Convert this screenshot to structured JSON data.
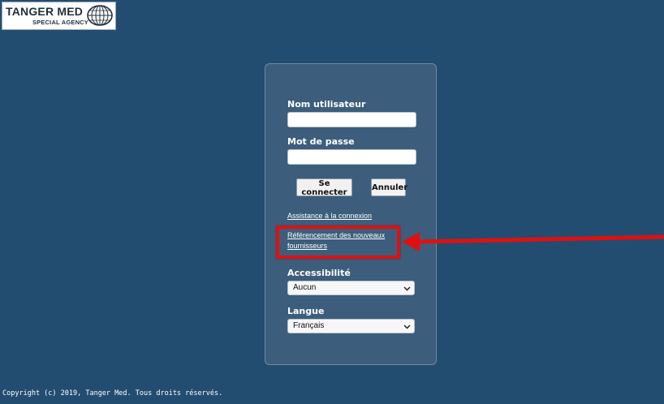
{
  "logo": {
    "main": "TANGER MED",
    "sub": "SPECIAL AGENCY"
  },
  "login": {
    "username_label": "Nom utilisateur",
    "username_value": "",
    "password_label": "Mot de passe",
    "password_value": "",
    "connect_label": "Se connecter",
    "cancel_label": "Annuler",
    "assist_link": "Assistance à la connexion",
    "supplier_link_line1": "Référencement des nouveaux",
    "supplier_link_line2": "fournisseurs",
    "accessibility_label": "Accessibilité",
    "accessibility_value": "Aucun",
    "language_label": "Langue",
    "language_value": "Français"
  },
  "footer": {
    "copyright": "Copyright (c) 2019, Tanger Med. Tous droits réservés."
  },
  "colors": {
    "background": "#234d70",
    "panel": "#3c5e7c",
    "highlight": "#e01010"
  }
}
